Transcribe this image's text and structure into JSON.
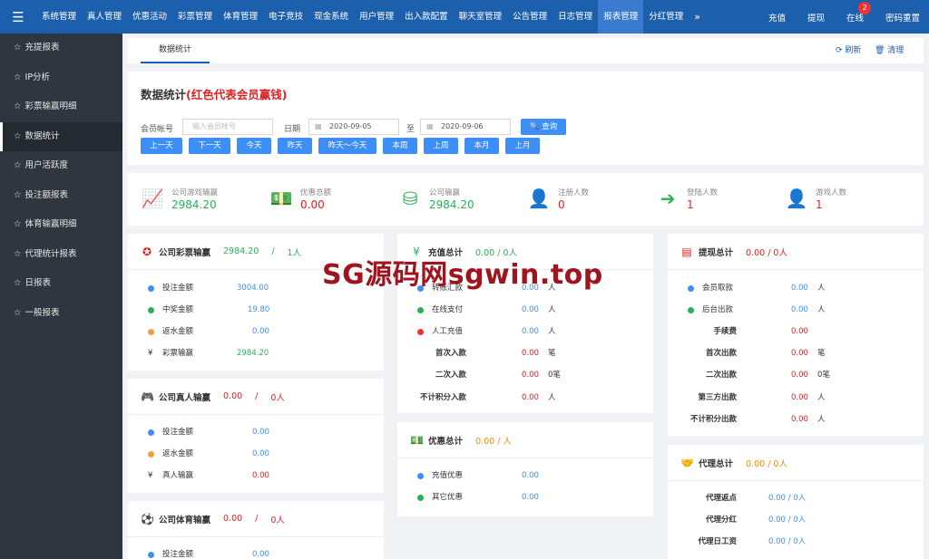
{
  "topbar": {
    "menu_icon": "menu-icon",
    "nav": [
      "系统管理",
      "真人管理",
      "优惠活动",
      "彩票管理",
      "体育管理",
      "电子竞技",
      "现金系统",
      "用户管理",
      "出入款配置",
      "聊天室管理",
      "公告管理",
      "日志管理",
      "报表管理",
      "分红管理"
    ],
    "active_nav": "报表管理",
    "more": "»",
    "right": [
      "充值",
      "提现",
      "在线",
      "密码重置"
    ],
    "online_badge": "2"
  },
  "sidebar": {
    "items": [
      "充提报表",
      "IP分析",
      "彩票输赢明细",
      "数据统计",
      "用户活跃度",
      "投注额报表",
      "体育输赢明细",
      "代理统计报表",
      "日报表",
      "一般报表"
    ],
    "active": "数据统计"
  },
  "tabbar": {
    "tab": "数据统计",
    "refresh": "刷新",
    "clear": "清理"
  },
  "filter": {
    "title": "数据统计",
    "title_note": "(红色代表会员赢钱)",
    "account_label": "会员帐号",
    "account_placeholder": "输入会员帐号",
    "date_label": "日期",
    "date_from": "2020-09-05",
    "to_label": "至",
    "date_to": "2020-09-06",
    "query": "查询",
    "quick": [
      "上一天",
      "下一天",
      "今天",
      "昨天",
      "昨天～今天",
      "本周",
      "上周",
      "本月",
      "上月"
    ]
  },
  "stats": [
    {
      "label": "公司游戏输赢",
      "value": "2984.20",
      "color": "#2bb058",
      "icon": "line-chart-icon"
    },
    {
      "label": "优惠总额",
      "value": "0.00",
      "color": "#e02020",
      "icon": "money-icon"
    },
    {
      "label": "公司输赢",
      "value": "2984.20",
      "color": "#2bb058",
      "icon": "database-icon"
    },
    {
      "label": "注册人数",
      "value": "0",
      "color": "#e02020",
      "icon": "user-plus-icon"
    },
    {
      "label": "登陆人数",
      "value": "1",
      "color": "#e02020",
      "icon": "sign-in-icon"
    },
    {
      "label": "游戏人数",
      "value": "1",
      "color": "#e02020",
      "icon": "user-icon"
    }
  ],
  "cards": {
    "lottery": {
      "title": "公司彩票输赢",
      "amount": "2984.20",
      "sep": "/",
      "count": "1人",
      "rows": [
        {
          "label": "投注金额",
          "value": "3004.00"
        },
        {
          "label": "中奖金额",
          "value": "19.80"
        },
        {
          "label": "返水金额",
          "value": "0.00"
        },
        {
          "label": "彩票输赢",
          "value": "2984.20"
        }
      ]
    },
    "live": {
      "title": "公司真人输赢",
      "amount": "0.00",
      "sep": "/",
      "count": "0人",
      "rows": [
        {
          "label": "投注金额",
          "value": "0.00"
        },
        {
          "label": "返水金额",
          "value": "0.00"
        },
        {
          "label": "真人输赢",
          "value": "0.00"
        }
      ]
    },
    "sports": {
      "title": "公司体育输赢",
      "amount": "0.00",
      "sep": "/",
      "count": "0人",
      "rows": [
        {
          "label": "投注金额",
          "value": "0.00"
        }
      ]
    },
    "deposit": {
      "title": "充值总计",
      "summary": "0.00 / 0人",
      "rows": [
        {
          "label": "转账汇款",
          "value": "0.00",
          "unit": "人"
        },
        {
          "label": "在线支付",
          "value": "0.00",
          "unit": "人"
        },
        {
          "label": "人工充值",
          "value": "0.00",
          "unit": "人"
        },
        {
          "label": "首次入款",
          "value": "0.00",
          "unit": "笔"
        },
        {
          "label": "二次入款",
          "value": "0.00",
          "unit": "0笔"
        },
        {
          "label": "不计积分入款",
          "value": "0.00",
          "unit": "人"
        }
      ]
    },
    "promo": {
      "title": "优惠总计",
      "summary": "0.00 / 人",
      "rows": [
        {
          "label": "充值优惠",
          "value": "0.00"
        },
        {
          "label": "其它优惠",
          "value": "0.00"
        }
      ]
    },
    "withdraw": {
      "title": "提现总计",
      "summary": "0.00 / 0人",
      "rows": [
        {
          "label": "会员取款",
          "value": "0.00",
          "unit": "人"
        },
        {
          "label": "后台出款",
          "value": "0.00",
          "unit": "人"
        },
        {
          "label": "手续费",
          "value": "0.00",
          "unit": ""
        },
        {
          "label": "首次出款",
          "value": "0.00",
          "unit": "笔"
        },
        {
          "label": "二次出款",
          "value": "0.00",
          "unit": "0笔"
        },
        {
          "label": "第三方出款",
          "value": "0.00",
          "unit": "人"
        },
        {
          "label": "不计积分出款",
          "value": "0.00",
          "unit": "人"
        }
      ]
    },
    "agent": {
      "title": "代理总计",
      "summary": "0.00 / 0人",
      "rows": [
        {
          "label": "代理返点",
          "value": "0.00 / 0人"
        },
        {
          "label": "代理分红",
          "value": "0.00 / 0人"
        },
        {
          "label": "代理日工资",
          "value": "0.00 / 0人"
        }
      ]
    }
  },
  "watermark": "SG源码网sgwin.top"
}
